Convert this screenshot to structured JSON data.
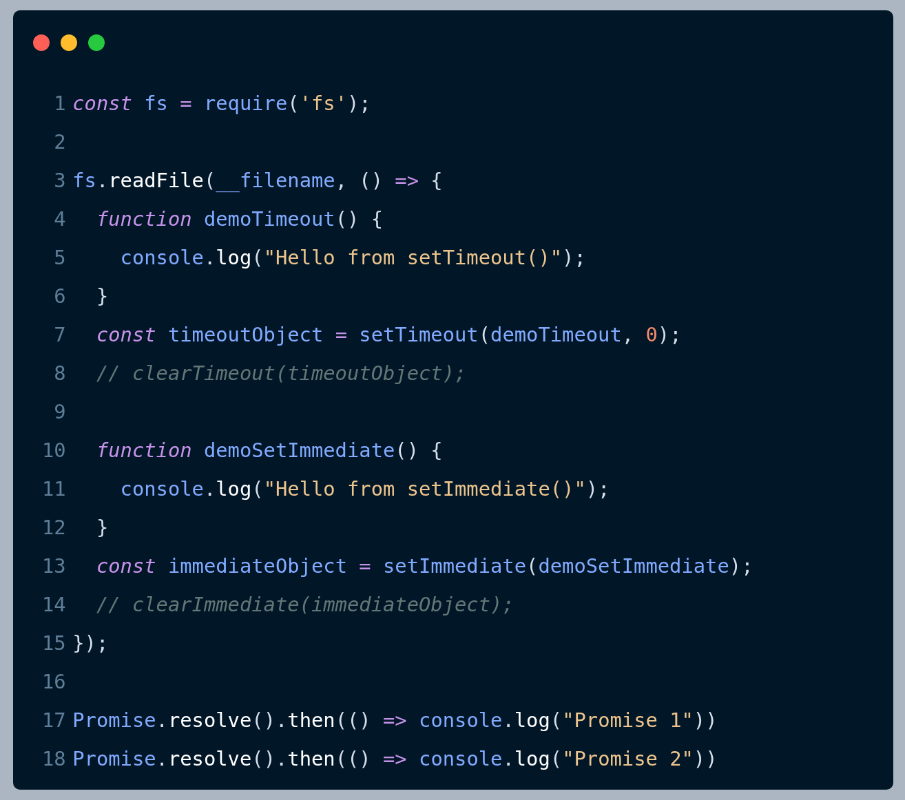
{
  "window_dots": [
    {
      "color": "#ff5f56"
    },
    {
      "color": "#ffbd2e"
    },
    {
      "color": "#27c93f"
    }
  ],
  "lines": [
    {
      "number": "1",
      "tokens": [
        {
          "text": "const",
          "kind": "keyword"
        },
        {
          "text": " fs ",
          "kind": "name"
        },
        {
          "text": "=",
          "kind": "operator"
        },
        {
          "text": " require",
          "kind": "name"
        },
        {
          "text": "(",
          "kind": "punct"
        },
        {
          "text": "'fs'",
          "kind": "string"
        },
        {
          "text": ");",
          "kind": "punct"
        }
      ]
    },
    {
      "number": "2"
    },
    {
      "number": "3",
      "tokens": [
        {
          "text": "fs",
          "kind": "name"
        },
        {
          "text": ".",
          "kind": "punct"
        },
        {
          "text": "readFile",
          "kind": "member"
        },
        {
          "text": "(",
          "kind": "punct"
        },
        {
          "text": "__filename",
          "kind": "name"
        },
        {
          "text": ", () ",
          "kind": "punct"
        },
        {
          "text": "=>",
          "kind": "operator"
        },
        {
          "text": " {",
          "kind": "punct"
        }
      ]
    },
    {
      "number": "4",
      "tokens": [
        {
          "text": "  function",
          "kind": "keyword"
        },
        {
          "text": " demoTimeout",
          "kind": "name"
        },
        {
          "text": "() {",
          "kind": "punct"
        }
      ]
    },
    {
      "number": "5",
      "tokens": [
        {
          "text": "    console",
          "kind": "name"
        },
        {
          "text": ".",
          "kind": "punct"
        },
        {
          "text": "log",
          "kind": "member"
        },
        {
          "text": "(",
          "kind": "punct"
        },
        {
          "text": "\"Hello from setTimeout()\"",
          "kind": "string"
        },
        {
          "text": ");",
          "kind": "punct"
        }
      ]
    },
    {
      "number": "6",
      "tokens": [
        {
          "text": "  }",
          "kind": "punct"
        }
      ]
    },
    {
      "number": "7",
      "tokens": [
        {
          "text": "  const",
          "kind": "keyword"
        },
        {
          "text": " timeoutObject ",
          "kind": "name"
        },
        {
          "text": "=",
          "kind": "operator"
        },
        {
          "text": " setTimeout",
          "kind": "name"
        },
        {
          "text": "(",
          "kind": "punct"
        },
        {
          "text": "demoTimeout",
          "kind": "name"
        },
        {
          "text": ", ",
          "kind": "punct"
        },
        {
          "text": "0",
          "kind": "number"
        },
        {
          "text": ");",
          "kind": "punct"
        }
      ]
    },
    {
      "number": "8",
      "tokens": [
        {
          "text": "  // clearTimeout(timeoutObject);",
          "kind": "comment"
        }
      ]
    },
    {
      "number": "9"
    },
    {
      "number": "10",
      "tokens": [
        {
          "text": "  function",
          "kind": "keyword"
        },
        {
          "text": " demoSetImmediate",
          "kind": "name"
        },
        {
          "text": "() {",
          "kind": "punct"
        }
      ]
    },
    {
      "number": "11",
      "tokens": [
        {
          "text": "    console",
          "kind": "name"
        },
        {
          "text": ".",
          "kind": "punct"
        },
        {
          "text": "log",
          "kind": "member"
        },
        {
          "text": "(",
          "kind": "punct"
        },
        {
          "text": "\"Hello from setImmediate()\"",
          "kind": "string"
        },
        {
          "text": ");",
          "kind": "punct"
        }
      ]
    },
    {
      "number": "12",
      "tokens": [
        {
          "text": "  }",
          "kind": "punct"
        }
      ]
    },
    {
      "number": "13",
      "tokens": [
        {
          "text": "  const",
          "kind": "keyword"
        },
        {
          "text": " immediateObject ",
          "kind": "name"
        },
        {
          "text": "=",
          "kind": "operator"
        },
        {
          "text": " setImmediate",
          "kind": "name"
        },
        {
          "text": "(",
          "kind": "punct"
        },
        {
          "text": "demoSetImmediate",
          "kind": "name"
        },
        {
          "text": ");",
          "kind": "punct"
        }
      ]
    },
    {
      "number": "14",
      "tokens": [
        {
          "text": "  // clearImmediate(immediateObject);",
          "kind": "comment"
        }
      ]
    },
    {
      "number": "15",
      "tokens": [
        {
          "text": "});",
          "kind": "punct"
        }
      ]
    },
    {
      "number": "16"
    },
    {
      "number": "17",
      "tokens": [
        {
          "text": "Promise",
          "kind": "name"
        },
        {
          "text": ".",
          "kind": "punct"
        },
        {
          "text": "resolve",
          "kind": "member"
        },
        {
          "text": "().",
          "kind": "punct"
        },
        {
          "text": "then",
          "kind": "member"
        },
        {
          "text": "(() ",
          "kind": "punct"
        },
        {
          "text": "=>",
          "kind": "operator"
        },
        {
          "text": " console",
          "kind": "name"
        },
        {
          "text": ".",
          "kind": "punct"
        },
        {
          "text": "log",
          "kind": "member"
        },
        {
          "text": "(",
          "kind": "punct"
        },
        {
          "text": "\"Promise 1\"",
          "kind": "string"
        },
        {
          "text": "))",
          "kind": "punct"
        }
      ]
    },
    {
      "number": "18",
      "tokens": [
        {
          "text": "Promise",
          "kind": "name"
        },
        {
          "text": ".",
          "kind": "punct"
        },
        {
          "text": "resolve",
          "kind": "member"
        },
        {
          "text": "().",
          "kind": "punct"
        },
        {
          "text": "then",
          "kind": "member"
        },
        {
          "text": "(() ",
          "kind": "punct"
        },
        {
          "text": "=>",
          "kind": "operator"
        },
        {
          "text": " console",
          "kind": "name"
        },
        {
          "text": ".",
          "kind": "punct"
        },
        {
          "text": "log",
          "kind": "member"
        },
        {
          "text": "(",
          "kind": "punct"
        },
        {
          "text": "\"Promise 2\"",
          "kind": "string"
        },
        {
          "text": "))",
          "kind": "punct"
        }
      ]
    }
  ]
}
